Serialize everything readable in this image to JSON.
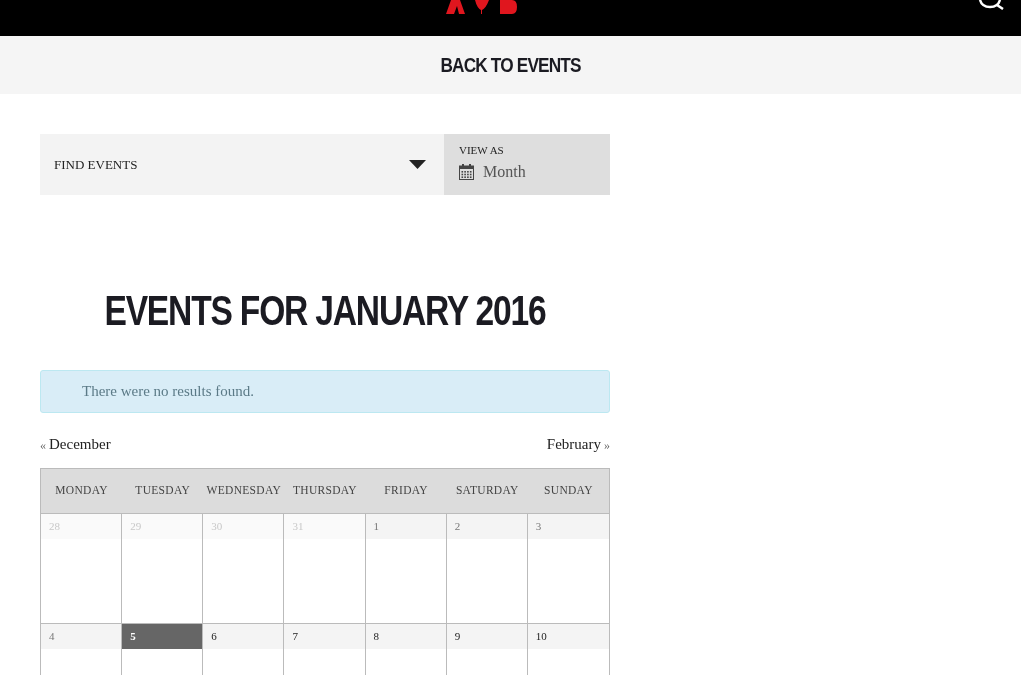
{
  "header": {
    "back_link": "BACK TO EVENTS"
  },
  "filter_bar": {
    "find_label": "FIND EVENTS",
    "view_as_label": "VIEW AS",
    "view_value": "Month"
  },
  "title": "EVENTS FOR JANUARY 2016",
  "notice": "There were no results found.",
  "month_nav": {
    "previous": {
      "arrow": "«",
      "label": "December"
    },
    "next": {
      "label": "February",
      "arrow": "»"
    }
  },
  "calendar": {
    "columns": [
      "MONDAY",
      "TUESDAY",
      "WEDNESDAY",
      "THURSDAY",
      "FRIDAY",
      "SATURDAY",
      "SUNDAY"
    ],
    "weeks": [
      [
        {
          "day": "28",
          "kind": "other"
        },
        {
          "day": "29",
          "kind": "other"
        },
        {
          "day": "30",
          "kind": "other"
        },
        {
          "day": "31",
          "kind": "other"
        },
        {
          "day": "1",
          "kind": "past"
        },
        {
          "day": "2",
          "kind": "past"
        },
        {
          "day": "3",
          "kind": "past"
        }
      ],
      [
        {
          "day": "4",
          "kind": "past"
        },
        {
          "day": "5",
          "kind": "today"
        },
        {
          "day": "6",
          "kind": "future"
        },
        {
          "day": "7",
          "kind": "future"
        },
        {
          "day": "8",
          "kind": "future"
        },
        {
          "day": "9",
          "kind": "future"
        },
        {
          "day": "10",
          "kind": "future"
        }
      ]
    ]
  }
}
